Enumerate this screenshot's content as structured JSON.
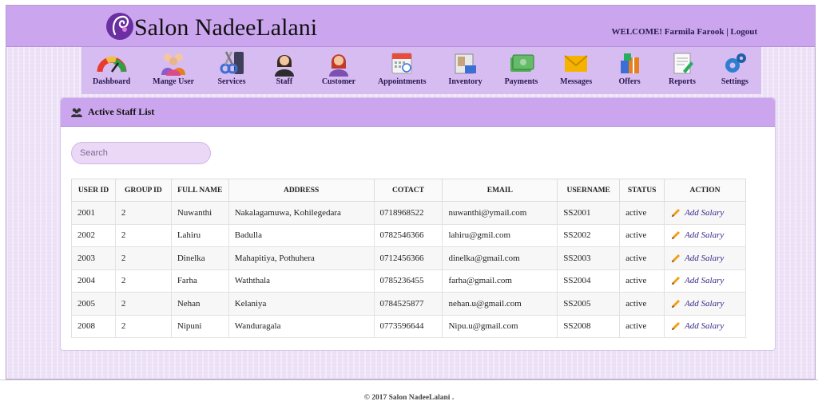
{
  "header": {
    "brand": "Salon NadeeLalani",
    "welcome": "WELCOME! Farmila Farook |",
    "logout": "Logout"
  },
  "nav": [
    {
      "label": "Dashboard",
      "icon": "gauge-icon"
    },
    {
      "label": "Mange User",
      "icon": "users-group-icon"
    },
    {
      "label": "Services",
      "icon": "scissors-icon"
    },
    {
      "label": "Staff",
      "icon": "staff-icon"
    },
    {
      "label": "Customer",
      "icon": "customer-icon"
    },
    {
      "label": "Appointments",
      "icon": "calendar-icon"
    },
    {
      "label": "Inventory",
      "icon": "inventory-icon"
    },
    {
      "label": "Payments",
      "icon": "money-icon"
    },
    {
      "label": "Messages",
      "icon": "envelope-icon"
    },
    {
      "label": "Offers",
      "icon": "gift-icon"
    },
    {
      "label": "Reports",
      "icon": "report-icon"
    },
    {
      "label": "Settings",
      "icon": "gears-icon"
    }
  ],
  "panel": {
    "title": "Active Staff List",
    "search_placeholder": "Search"
  },
  "table": {
    "headers": [
      "USER ID",
      "GROUP ID",
      "FULL NAME",
      "ADDRESS",
      "COTACT",
      "EMAIL",
      "USERNAME",
      "STATUS",
      "ACTION"
    ],
    "action_label": "Add Salary",
    "rows": [
      {
        "user_id": "2001",
        "group_id": "2",
        "name": "Nuwanthi",
        "address": "Nakalagamuwa, Kohilegedara",
        "contact": "0718968522",
        "email": "nuwanthi@ymail.com",
        "username": "SS2001",
        "status": "active"
      },
      {
        "user_id": "2002",
        "group_id": "2",
        "name": "Lahiru",
        "address": "Badulla",
        "contact": "0782546366",
        "email": "lahiru@gmil.com",
        "username": "SS2002",
        "status": "active"
      },
      {
        "user_id": "2003",
        "group_id": "2",
        "name": "Dinelka",
        "address": "Mahapitiya, Pothuhera",
        "contact": "0712456366",
        "email": "dinelka@gmail.com",
        "username": "SS2003",
        "status": "active"
      },
      {
        "user_id": "2004",
        "group_id": "2",
        "name": "Farha",
        "address": "Waththala",
        "contact": "0785236455",
        "email": "farha@gmail.com",
        "username": "SS2004",
        "status": "active"
      },
      {
        "user_id": "2005",
        "group_id": "2",
        "name": "Nehan",
        "address": "Kelaniya",
        "contact": "0784525877",
        "email": "nehan.u@gmail.com",
        "username": "SS2005",
        "status": "active"
      },
      {
        "user_id": "2008",
        "group_id": "2",
        "name": "Nipuni",
        "address": "Wanduragala",
        "contact": "0773596644",
        "email": "Nipu.u@gmail.com",
        "username": "SS2008",
        "status": "active"
      }
    ]
  },
  "footer": {
    "copyright": "© 2017 Salon NadeeLalani ."
  },
  "colors": {
    "header_purple": "#cba6ee",
    "nav_purple": "#d6bcf0",
    "background_lavender": "#ece0f6",
    "link_blue": "#3b2a8a"
  }
}
